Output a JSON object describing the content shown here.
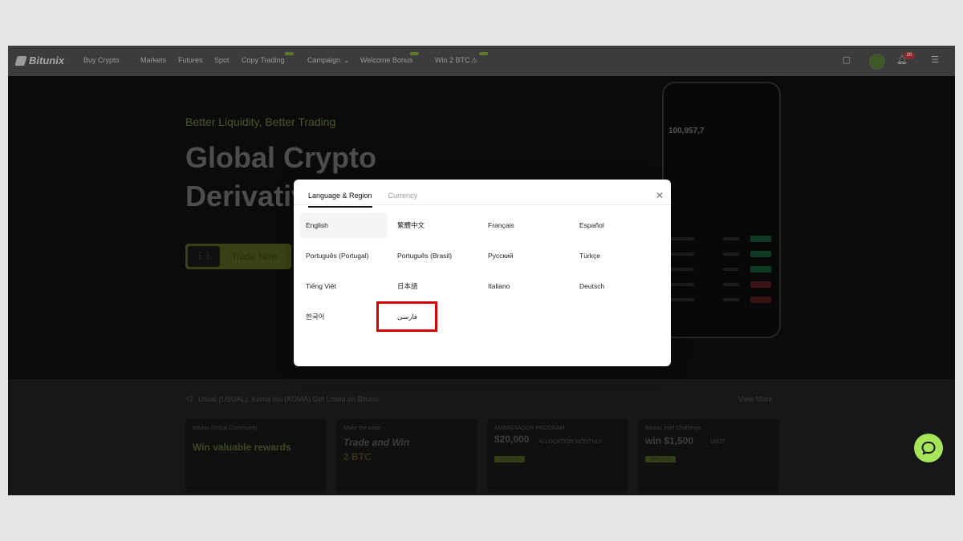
{
  "nav": {
    "logo": "Bitunix",
    "items": [
      "Buy Crypto",
      "Markets",
      "Futures",
      "Spot",
      "Copy Trading",
      "Campaign",
      "Welcome Bonus",
      "Win 2 BTC"
    ],
    "notification_count": "20"
  },
  "hero": {
    "tagline": "Better Liquidity, Better Trading",
    "headline": "Global Crypto Derivatives",
    "cta": "Trade Now",
    "phone_balance": "100,957,7"
  },
  "news": {
    "text": "Usual (USUAL), Koma Inu (KOMA) Get Listed on Bitunix",
    "view_more": "View More"
  },
  "banners": [
    {
      "line1": "Bitunix Global Community",
      "big": "Win valuable rewards",
      "line2": "",
      "button": ""
    },
    {
      "line1": "Make the trade",
      "big": "Trade and Win",
      "line2": "2 BTC",
      "button": ""
    },
    {
      "line1": "AMBASSADOR PROGRAM",
      "big": "$20,000",
      "line2": "ALLOCATION MONTHLY",
      "button": "JOIN NOW"
    },
    {
      "line1": "Bitunix Intel Challenge",
      "big": "win $1,500",
      "line2": "USDT",
      "button": "JOIN NOW"
    }
  ],
  "modal": {
    "tabs": [
      "Language & Region",
      "Currency"
    ],
    "active_tab": "Language & Region",
    "languages": [
      "English",
      "繁體中文",
      "Français",
      "Español",
      "Português (Portugal)",
      "Português (Brasil)",
      "Русский",
      "Türkçe",
      "Tiếng Việt",
      "日本語",
      "Italiano",
      "Deutsch",
      "한국어",
      "فارسی"
    ],
    "selected_language": "English",
    "highlighted_language": "فارسی"
  },
  "colors": {
    "accent_green": "#a6e45a",
    "highlight_red": "#d90000"
  }
}
